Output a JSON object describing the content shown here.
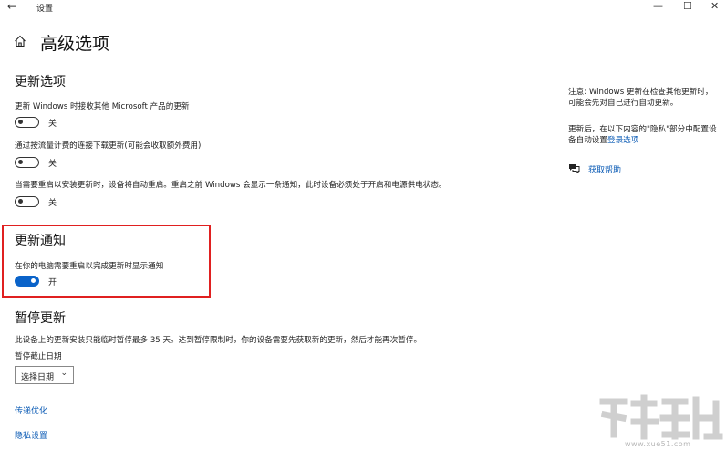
{
  "window": {
    "back_icon": "back-arrow-icon",
    "app_title": "设置",
    "controls": {
      "minimize": "—",
      "maximize": "☐",
      "close": "✕"
    }
  },
  "page": {
    "home_icon": "home-icon",
    "title": "高级选项"
  },
  "update_options": {
    "title": "更新选项",
    "items": [
      {
        "label": "更新 Windows 时接收其他 Microsoft 产品的更新",
        "state": "关",
        "on": false
      },
      {
        "label": "通过按流量计费的连接下载更新(可能会收取额外费用)",
        "state": "关",
        "on": false
      },
      {
        "label": "当需要重启以安装更新时，设备将自动重启。重启之前 Windows 会显示一条通知，此时设备必须处于开启和电源供电状态。",
        "state": "关",
        "on": false
      }
    ]
  },
  "update_notification": {
    "title": "更新通知",
    "label": "在你的电脑需要重启以完成更新时显示通知",
    "state": "开",
    "on": true,
    "highlight_color": "#e02020"
  },
  "pause_updates": {
    "title": "暂停更新",
    "description": "此设备上的更新安装只能临时暂停最多 35 天。达到暂停限制时，你的设备需要先获取新的更新，然后才能再次暂停。",
    "date_label": "暂停截止日期",
    "dropdown_value": "选择日期",
    "dropdown_icon": "chevron-down-icon"
  },
  "links": {
    "delivery_optimization": "传递优化",
    "privacy_settings": "隐私设置"
  },
  "sidebar": {
    "note": "注意: Windows 更新在检查其他更新时，可能会先对自己进行自动更新。",
    "privacy_note_prefix": "更新后，在以下内容的\"隐私\"部分中配置设备自动设置",
    "privacy_link": "登录选项",
    "help_icon": "chat-help-icon",
    "help_link": "获取帮助"
  },
  "colors": {
    "accent": "#0a63c9",
    "link": "#0b5bb5",
    "highlight": "#e02020"
  },
  "watermark": {
    "text": "www.xue51.com"
  }
}
